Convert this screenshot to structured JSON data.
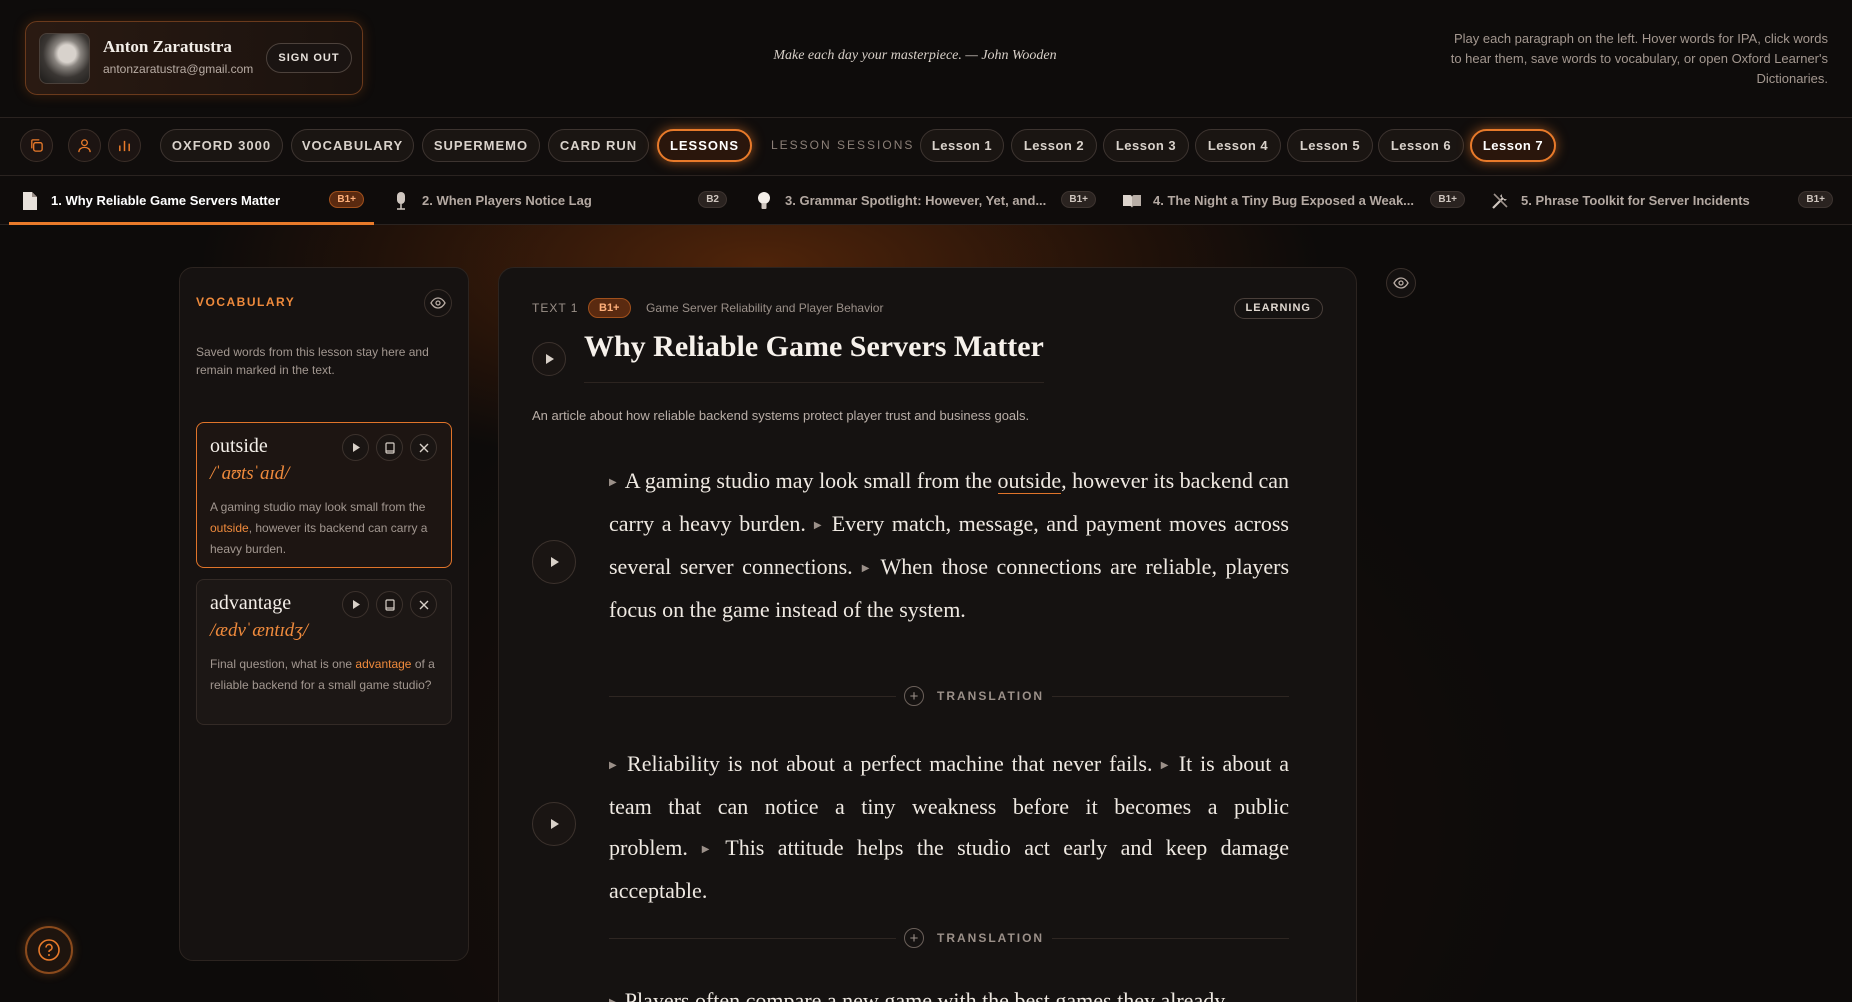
{
  "header": {
    "user_name": "Anton Zaratustra",
    "user_email": "antonzaratustra@gmail.com",
    "sign_out": "SIGN OUT",
    "quote": "Make each day your masterpiece. — John Wooden",
    "instructions": "Play each paragraph on the left. Hover words for IPA, click words to hear them, save words to vocabulary, or open Oxford Learner's Dictionaries."
  },
  "nav": {
    "icons": [
      "copy-icon",
      "user-icon",
      "stats-icon"
    ],
    "tabs": [
      "OXFORD 3000",
      "VOCABULARY",
      "SUPERMEMO",
      "CARD RUN",
      "LESSONS"
    ],
    "active_tab": "LESSONS",
    "sessions_label": "LESSON SESSIONS",
    "lessons": [
      "Lesson 1",
      "Lesson 2",
      "Lesson 3",
      "Lesson 4",
      "Lesson 5",
      "Lesson 6",
      "Lesson 7"
    ],
    "active_lesson": "Lesson 7"
  },
  "text_tabs": [
    {
      "title": "1. Why Reliable Game Servers Matter",
      "level": "B1+",
      "icon": "document-icon",
      "active": true
    },
    {
      "title": "2. When Players Notice Lag",
      "level": "B2",
      "icon": "microphone-icon",
      "active": false
    },
    {
      "title": "3. Grammar Spotlight: However, Yet, and...",
      "level": "B1+",
      "icon": "lightbulb-icon",
      "active": false
    },
    {
      "title": "4. The Night a Tiny Bug Exposed a Weak...",
      "level": "B1+",
      "icon": "book-icon",
      "active": false
    },
    {
      "title": "5. Phrase Toolkit for Server Incidents",
      "level": "B1+",
      "icon": "tools-icon",
      "active": false
    }
  ],
  "vocabulary": {
    "title": "VOCABULARY",
    "description": "Saved words from this lesson stay here and remain marked in the text.",
    "items": [
      {
        "word": "outside",
        "ipa": "/ˈaʊtsˈaɪd/",
        "sentence_before": "A gaming studio may look small from the ",
        "highlight": "outside",
        "sentence_after": ", however its backend can carry a heavy burden."
      },
      {
        "word": "advantage",
        "ipa": "/ædvˈæntɪdʒ/",
        "sentence_before": "Final question, what is one ",
        "highlight": "advantage",
        "sentence_after": " of a reliable backend for a small game studio?"
      }
    ]
  },
  "text": {
    "label": "TEXT 1",
    "level": "B1+",
    "topic": "Game Server Reliability and Player Behavior",
    "status": "LEARNING",
    "title": "Why Reliable Game Servers Matter",
    "subtitle": "An article about how reliable backend systems protect player trust and business goals.",
    "translation_label": "TRANSLATION",
    "p1": {
      "s1_before": "A gaming studio may look small from the ",
      "s1_word": "outside",
      "s1_after": ", however its backend can carry a heavy burden.",
      "s2": "Every match, message, and payment moves across several server connections.",
      "s3": "When those connections are reliable, players focus on the game instead of the system."
    },
    "p2": {
      "s1": "Reliability is not about a perfect machine that never fails.",
      "s2": "It is about a team that can notice a tiny weakness before it becomes a public problem.",
      "s3": "This attitude helps the studio act early and keep damage acceptable."
    },
    "p3_partial": "Players often compare a new game with the best games they already"
  },
  "colors": {
    "accent": "#e87a2a",
    "background": "#0d0b0a",
    "panel": "#161211"
  }
}
